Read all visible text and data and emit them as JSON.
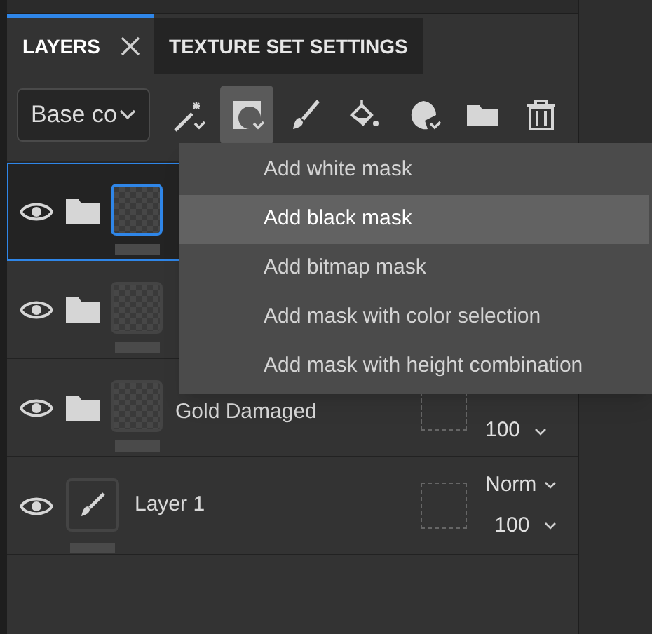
{
  "tabs": [
    {
      "label": "LAYERS",
      "selected": true,
      "closable": true
    },
    {
      "label": "TEXTURE SET SETTINGS",
      "selected": false,
      "closable": false
    }
  ],
  "channel_dropdown": {
    "value": "Base co"
  },
  "toolbar": [
    {
      "kind": "wand",
      "selected": false
    },
    {
      "kind": "mask",
      "selected": true
    },
    {
      "kind": "brush",
      "selected": false
    },
    {
      "kind": "fill",
      "selected": false
    },
    {
      "kind": "effect",
      "selected": false
    },
    {
      "kind": "folder",
      "selected": false
    },
    {
      "kind": "trash",
      "selected": false
    }
  ],
  "layers": [
    {
      "kind": "folder",
      "selected": true
    },
    {
      "kind": "folder",
      "selected": false
    },
    {
      "kind": "folder",
      "selected": false,
      "name": "Gold Damaged",
      "opacity": "100"
    },
    {
      "kind": "paint",
      "selected": false,
      "name": "Layer 1",
      "blend": "Norm",
      "opacity": "100"
    }
  ],
  "menu": [
    {
      "label": "Add white mask",
      "selected": false
    },
    {
      "label": "Add black mask",
      "selected": true
    },
    {
      "label": "Add bitmap mask",
      "selected": false
    },
    {
      "label": "Add mask with color selection",
      "selected": false
    },
    {
      "label": "Add mask with height combination",
      "selected": false
    }
  ]
}
